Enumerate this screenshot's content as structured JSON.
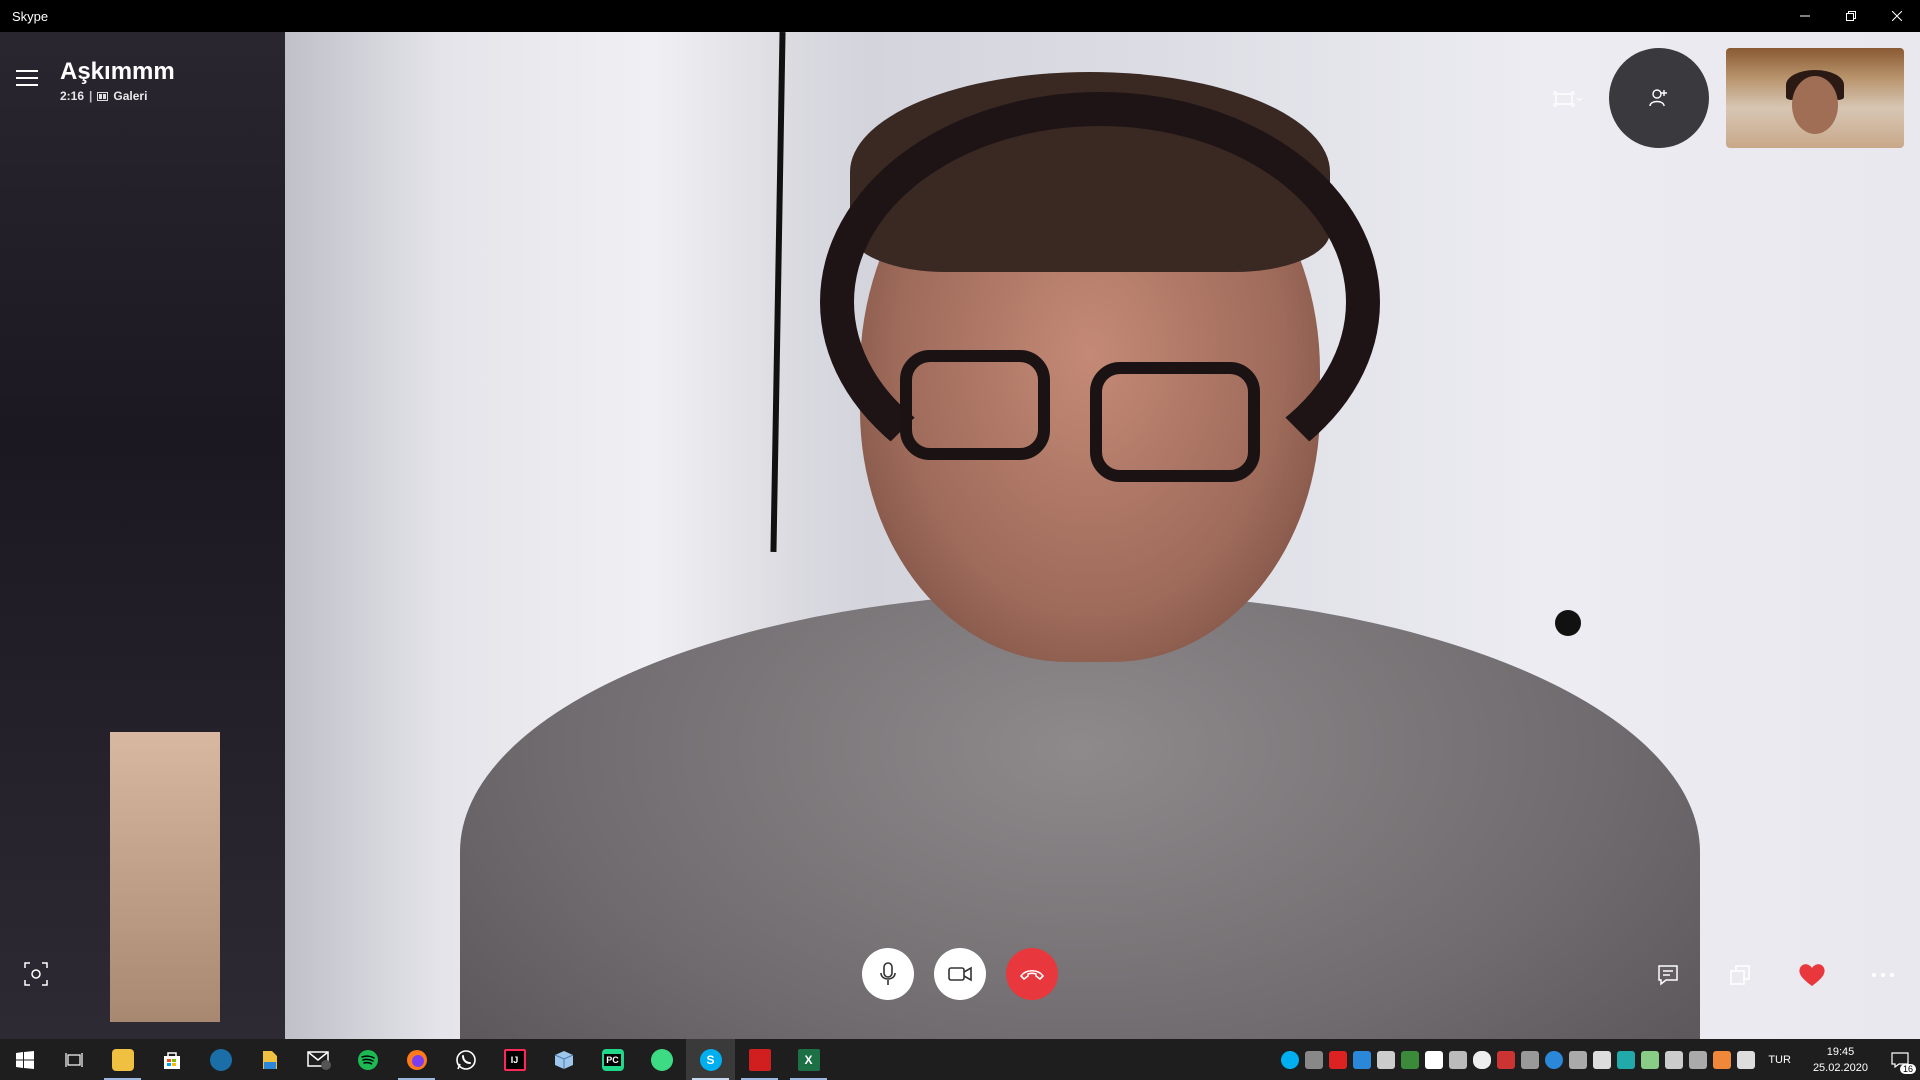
{
  "window": {
    "title": "Skype"
  },
  "call": {
    "contact_name": "Aşkımmm",
    "duration": "2:16",
    "separator": "|",
    "view_mode": "Galeri"
  },
  "colors": {
    "hangup": "#e8383d",
    "heart": "#e8383d",
    "taskbar": "#1e1e1e"
  },
  "taskbar": {
    "apps": [
      {
        "name": "start",
        "icon": "windows-icon",
        "running": false
      },
      {
        "name": "task-view",
        "icon": "task-view-icon",
        "running": false
      },
      {
        "name": "file-explorer",
        "icon": "folder-icon",
        "running": true
      },
      {
        "name": "store",
        "icon": "store-icon",
        "running": false
      },
      {
        "name": "steam",
        "icon": "steam-icon",
        "running": false
      },
      {
        "name": "files",
        "icon": "file-icon",
        "running": false
      },
      {
        "name": "mail",
        "icon": "mail-icon",
        "running": false,
        "badge": "3"
      },
      {
        "name": "spotify",
        "icon": "spotify-icon",
        "running": false
      },
      {
        "name": "firefox",
        "icon": "firefox-icon",
        "running": true
      },
      {
        "name": "whatsapp",
        "icon": "whatsapp-icon",
        "running": false
      },
      {
        "name": "intellij",
        "icon": "intellij-icon",
        "running": false
      },
      {
        "name": "3d-box",
        "icon": "box-icon",
        "running": false
      },
      {
        "name": "pycharm",
        "icon": "pycharm-icon",
        "running": false
      },
      {
        "name": "android-studio",
        "icon": "android-icon",
        "running": false
      },
      {
        "name": "skype",
        "icon": "skype-icon",
        "running": true,
        "active": true
      },
      {
        "name": "acrobat",
        "icon": "pdf-icon",
        "running": true
      },
      {
        "name": "excel",
        "icon": "excel-icon",
        "running": true
      }
    ],
    "language": "TUR",
    "time": "19:45",
    "date": "25.02.2020",
    "notifications": "16"
  }
}
